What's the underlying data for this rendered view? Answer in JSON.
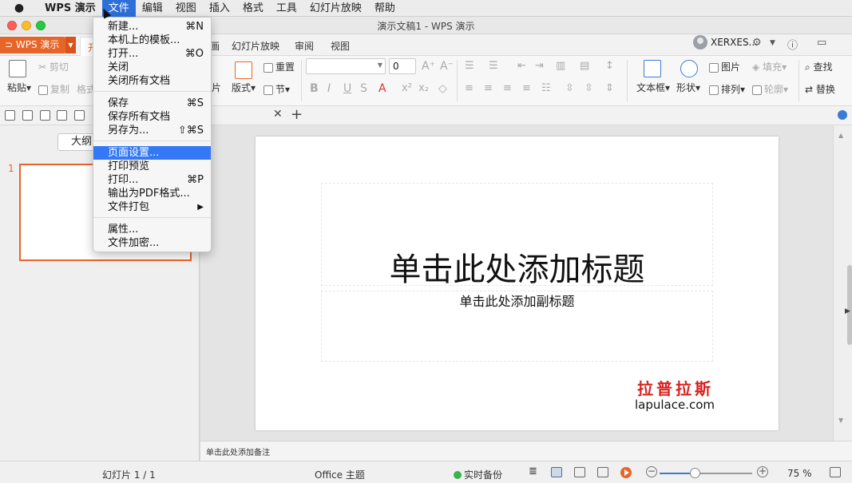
{
  "menubar": {
    "apple": "",
    "items": [
      "WPS 演示",
      "文件",
      "编辑",
      "视图",
      "插入",
      "格式",
      "工具",
      "幻灯片放映",
      "帮助"
    ]
  },
  "window": {
    "title": "演示文稿1 - WPS 演示"
  },
  "tabs": {
    "wps_button": "WPS 演示",
    "start_partial": "开",
    "items": [
      "画",
      "幻灯片放映",
      "审阅",
      "视图"
    ],
    "user_name": "XERXES..."
  },
  "ribbon": {
    "paste": "粘贴",
    "cut": "剪切",
    "copy": "复制",
    "format_painter": "格式",
    "picture_partial": "片",
    "layout": "版式",
    "reset": "重置",
    "section": "节",
    "font_size": "0",
    "textbox": "文本框",
    "shape": "形状",
    "picture": "图片",
    "arrange": "排列",
    "fill": "填充",
    "outline": "轮廓",
    "find": "查找",
    "replace": "替换"
  },
  "left_panel": {
    "outline_button": "大纲",
    "slide_number": "1"
  },
  "slide": {
    "title": "单击此处添加标题",
    "subtitle": "单击此处添加副标题",
    "watermark_cn": "拉普拉斯",
    "watermark_en": "lapulace.com"
  },
  "notes": {
    "placeholder": "单击此处添加备注"
  },
  "status": {
    "slide_counter": "幻灯片 1 / 1",
    "theme": "Office 主题",
    "backup": "实时备份",
    "zoom": "75 %",
    "zoom_fraction": 0.38
  },
  "file_menu": {
    "items": [
      {
        "label": "新建...",
        "shortcut": "⌘N"
      },
      {
        "label": "本机上的模板...",
        "shortcut": ""
      },
      {
        "label": "打开...",
        "shortcut": "⌘O"
      },
      {
        "label": "关闭",
        "shortcut": ""
      },
      {
        "label": "关闭所有文档",
        "shortcut": ""
      },
      {
        "label": "保存",
        "shortcut": "⌘S"
      },
      {
        "label": "保存所有文档",
        "shortcut": ""
      },
      {
        "label": "另存为...",
        "shortcut": "⇧⌘S"
      },
      {
        "label": "页面设置...",
        "shortcut": ""
      },
      {
        "label": "打印预览",
        "shortcut": ""
      },
      {
        "label": "打印...",
        "shortcut": "⌘P"
      },
      {
        "label": "输出为PDF格式...",
        "shortcut": ""
      },
      {
        "label": "文件打包",
        "shortcut": "▶"
      },
      {
        "label": "属性...",
        "shortcut": ""
      },
      {
        "label": "文件加密...",
        "shortcut": ""
      }
    ]
  }
}
